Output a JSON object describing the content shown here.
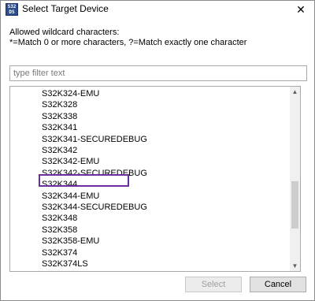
{
  "window": {
    "title": "Select Target Device",
    "icon": "s32-device-icon",
    "icon_text": "S32 DS"
  },
  "description": {
    "line1": "Allowed wildcard characters:",
    "line2": "*=Match 0 or more characters, ?=Match exactly one character"
  },
  "filter": {
    "placeholder": "type filter text",
    "value": ""
  },
  "devices": [
    "S32K324-EMU",
    "S32K328",
    "S32K338",
    "S32K341",
    "S32K341-SECUREDEBUG",
    "S32K342",
    "S32K342-EMU",
    "S32K342-SECUREDEBUG",
    "S32K344",
    "S32K344-EMU",
    "S32K344-SECUREDEBUG",
    "S32K348",
    "S32K358",
    "S32K358-EMU",
    "S32K374",
    "S32K374LS"
  ],
  "highlighted_device": "S32K344",
  "scroll": {
    "position_fraction": 0.72,
    "visible_fraction": 0.29
  },
  "buttons": {
    "select_label": "Select",
    "select_enabled": false,
    "cancel_label": "Cancel"
  },
  "colors": {
    "highlight_border": "#6a2ea0",
    "disabled_text": "#a0a0a0"
  }
}
